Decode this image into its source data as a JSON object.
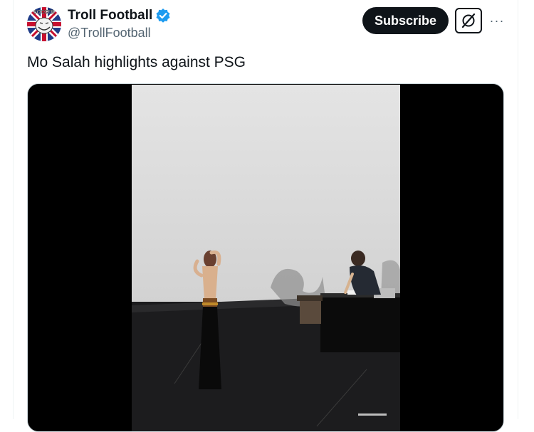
{
  "account": {
    "display_name": "Troll Football",
    "handle": "@TrollFootball",
    "avatar_icon": "troll-face-union-jack-avatar",
    "avatar_text": "SOCCER",
    "verified_icon": "verified-badge-icon",
    "verified_color": "#1d9bf0"
  },
  "actions": {
    "subscribe_label": "Subscribe",
    "grok_icon": "grok-icon",
    "more_icon": "more-options-icon",
    "more_glyph": "···"
  },
  "tweet": {
    "text": "Mo Salah highlights against PSG"
  },
  "media": {
    "type": "video",
    "background_color": "#000000",
    "scene": "performer-on-stage"
  }
}
